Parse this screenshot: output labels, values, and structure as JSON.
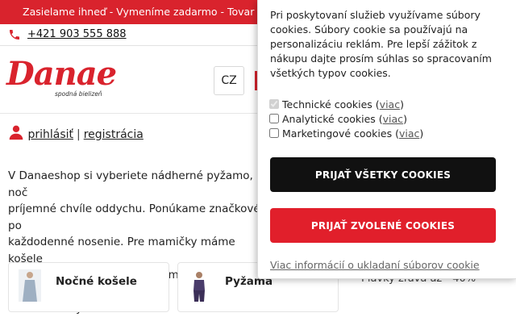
{
  "topbar": {
    "text": "Zasielame ihneď - Vymeníme zadarmo - Tovar mô"
  },
  "contact": {
    "phone": "+421 903 555 888"
  },
  "logo": {
    "brand": "Danae",
    "tagline": "spodná bielizeň"
  },
  "header": {
    "language": "CZ"
  },
  "account": {
    "login": "prihlásiť",
    "separator": "|",
    "register": "registrácia"
  },
  "intro": {
    "text": "V Danaeshop si vyberiete nádherné pyžamo, noč\npríjemné chvíle oddychu. Ponúkame značkové po\nkaždodenné nosenie. Pre mamičky máme košele\nžupany do pôrodnice. Zasielame ihneď, vymením\ntu si určite vyberiete!"
  },
  "categories": [
    {
      "label": "Nočné košele",
      "icon": "nightgown-thumb"
    },
    {
      "label": "Pyžama",
      "icon": "pajama-thumb"
    }
  ],
  "promo": {
    "text": "Plavky zľava až - 40%"
  },
  "cookie_banner": {
    "description": "Pri poskytovaní služieb využívame súbory\ncookies. Súbory cookie sa používajú na\npersonalizáciu reklám. Pre lepší zážitok z\nnákupu dajte prosím súhlas so spracovaním\nvšetkých typov cookies.",
    "options": [
      {
        "label": "Technické cookies",
        "link": "viac",
        "checked": true,
        "disabled": true
      },
      {
        "label": "Analytické cookies",
        "link": "viac",
        "checked": false,
        "disabled": false
      },
      {
        "label": "Marketingové cookies",
        "link": "viac",
        "checked": false,
        "disabled": false
      }
    ],
    "accept_all": "PRIJAŤ VŠETKY COOKIES",
    "accept_selected": "PRIJAŤ ZVOLENÉ COOKIES",
    "more_info": "Viac informácií o ukladaní súborov cookie"
  },
  "colors": {
    "brand_red": "#d9232d",
    "button_black": "#111111",
    "button_red": "#e11f2b"
  }
}
